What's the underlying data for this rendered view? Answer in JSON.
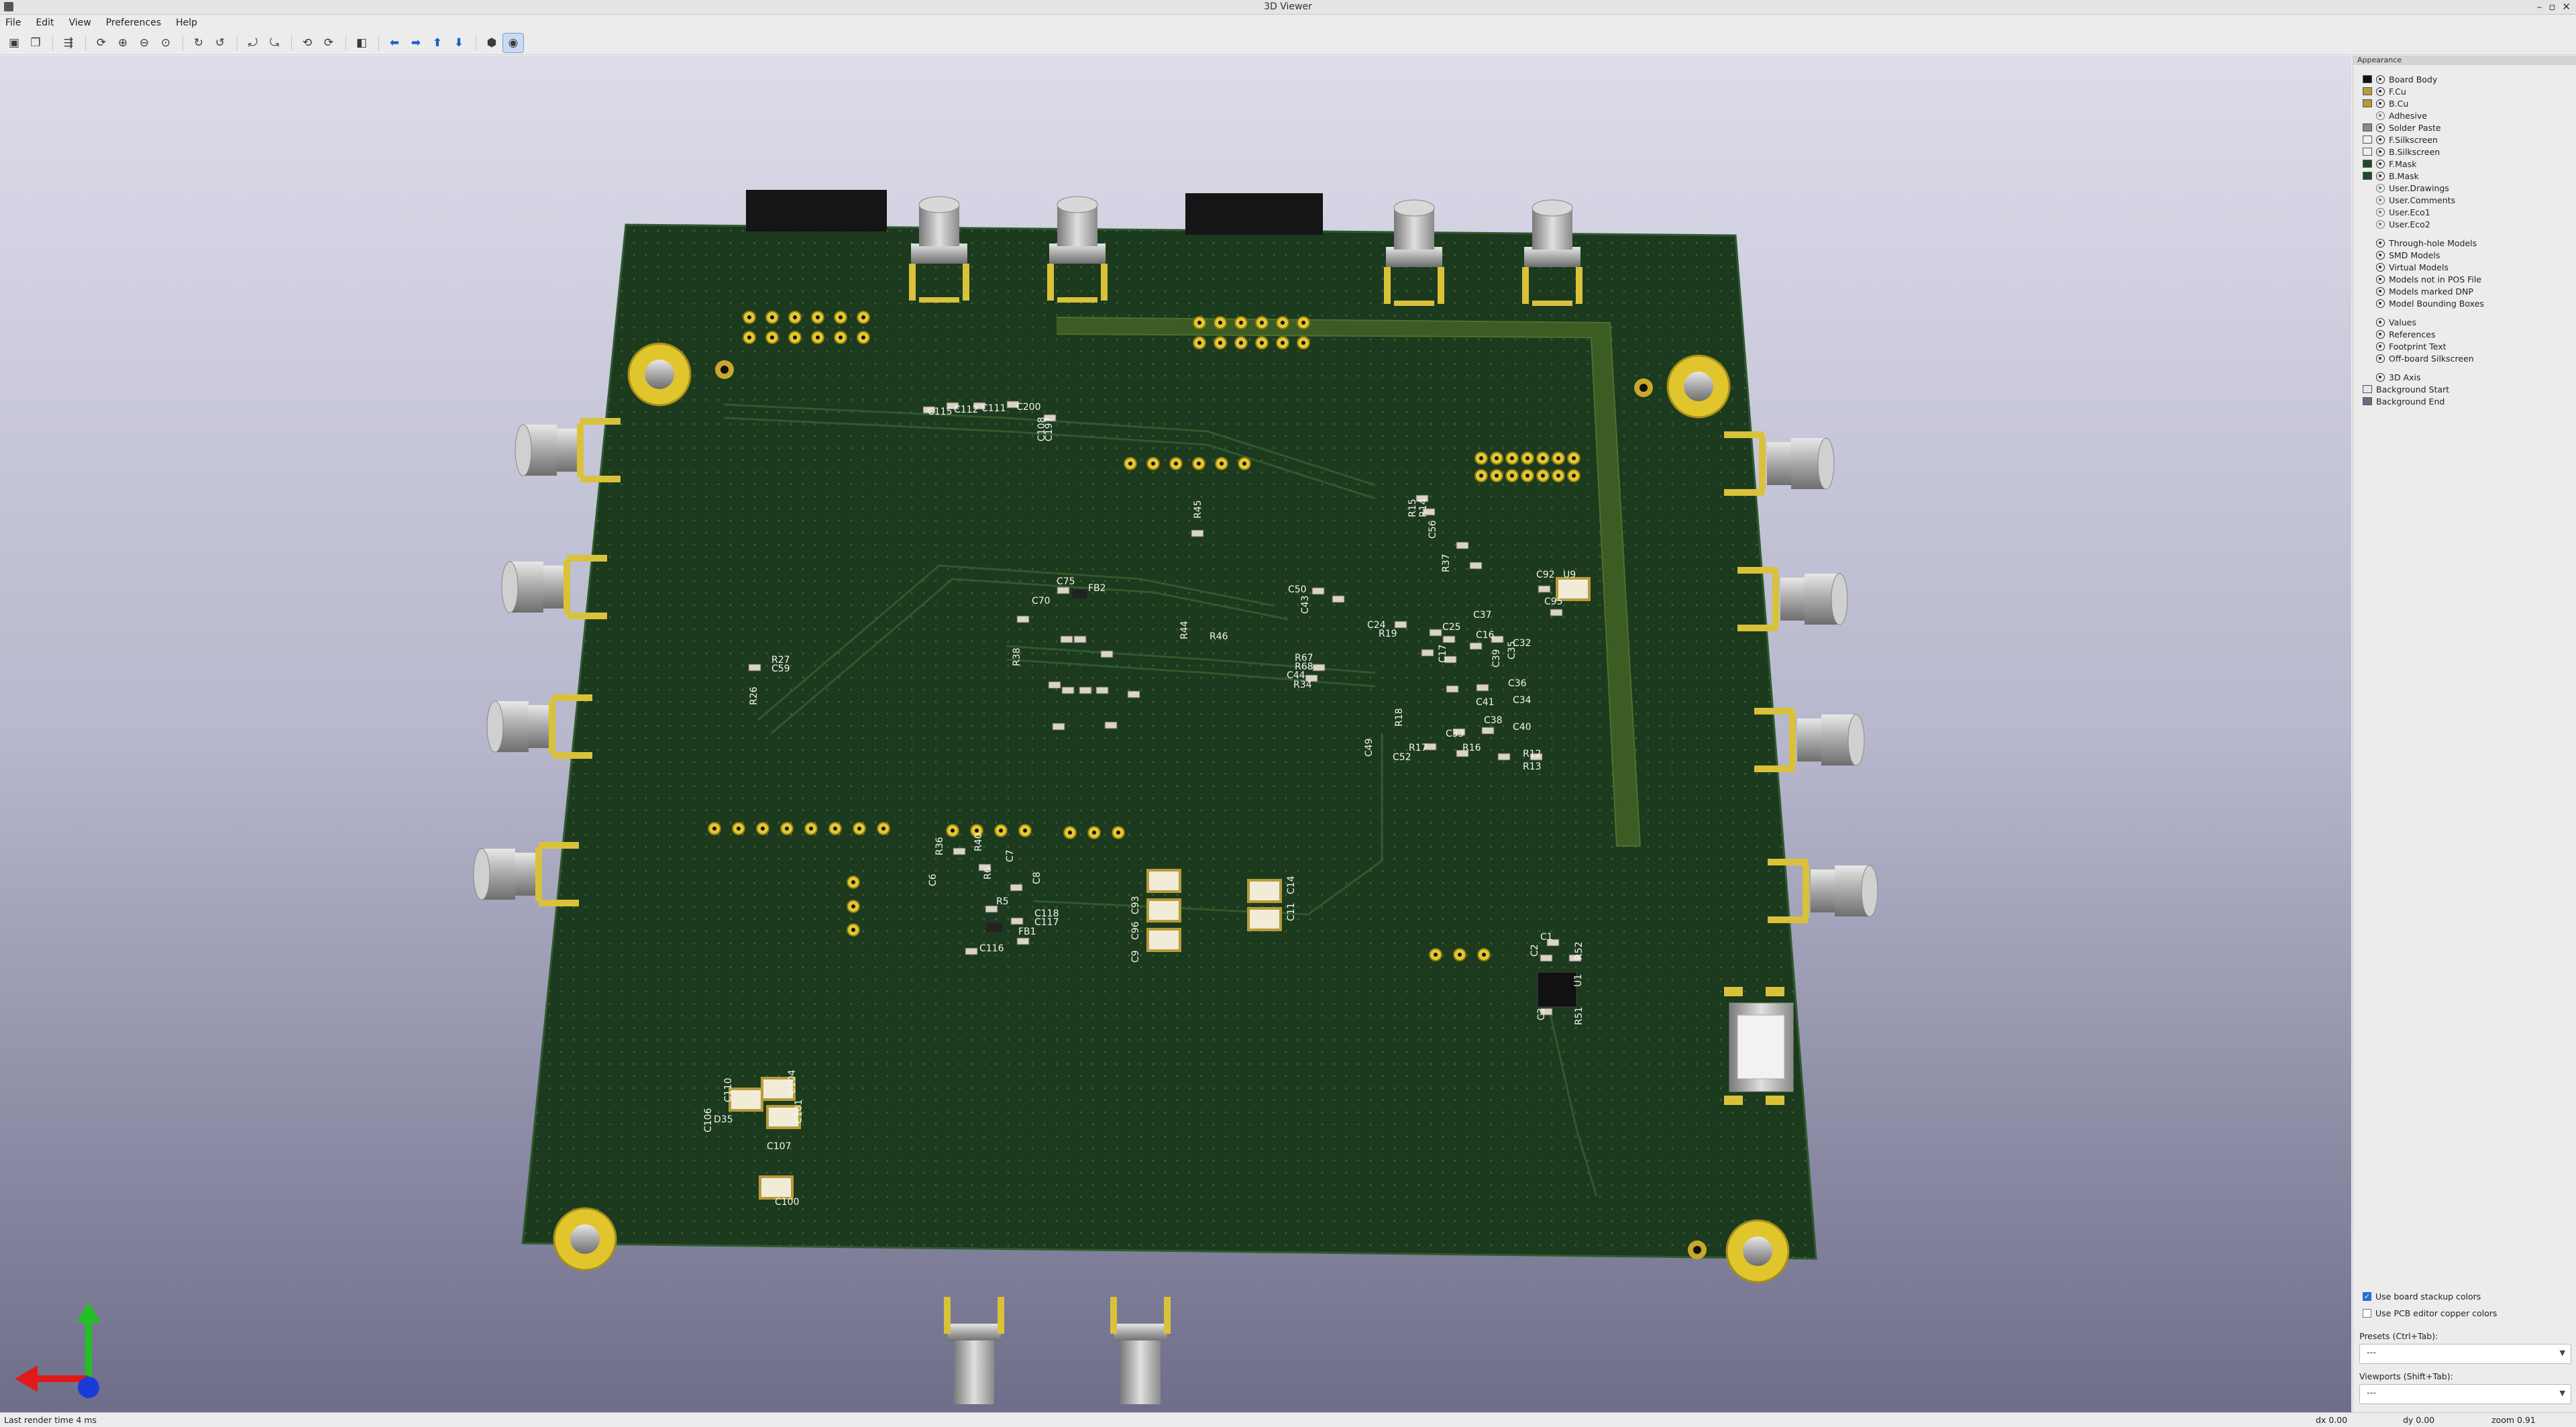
{
  "window": {
    "title": "3D Viewer",
    "controls": [
      "–",
      "▫",
      "✕"
    ]
  },
  "menu": [
    "File",
    "Edit",
    "View",
    "Preferences",
    "Help"
  ],
  "toolbar": [
    {
      "name": "export-image-button",
      "glyph": "▣"
    },
    {
      "name": "copy-button",
      "glyph": "❐"
    },
    {
      "name": "raytrace-button",
      "glyph": "⇶"
    },
    {
      "name": "reload-button",
      "glyph": "⟳"
    },
    {
      "name": "zoom-in-button",
      "glyph": "⊕"
    },
    {
      "name": "zoom-out-button",
      "glyph": "⊖"
    },
    {
      "name": "zoom-fit-button",
      "glyph": "⊙"
    },
    {
      "name": "rotate-x-cw-button",
      "glyph": "↻"
    },
    {
      "name": "rotate-x-ccw-button",
      "glyph": "↺"
    },
    {
      "name": "rotate-y-cw-button",
      "glyph": "⤾"
    },
    {
      "name": "rotate-y-ccw-button",
      "glyph": "⤿"
    },
    {
      "name": "rotate-z-cw-button",
      "glyph": "⟲"
    },
    {
      "name": "rotate-z-ccw-button",
      "glyph": "⟳"
    },
    {
      "name": "flip-board-button",
      "glyph": "◧"
    },
    {
      "name": "pan-left-button",
      "glyph": "⬅",
      "blue": true
    },
    {
      "name": "pan-right-button",
      "glyph": "➡",
      "blue": true
    },
    {
      "name": "pan-up-button",
      "glyph": "⬆",
      "blue": true
    },
    {
      "name": "pan-down-button",
      "glyph": "⬇",
      "blue": true
    },
    {
      "name": "orthographic-button",
      "glyph": "⬢"
    },
    {
      "name": "appearance-toggle-button",
      "glyph": "◉",
      "active": true
    }
  ],
  "appearance": {
    "title": "Appearance",
    "layers": [
      {
        "label": "Board Body",
        "color": "#111111"
      },
      {
        "label": "F.Cu",
        "color": "#b79b3a"
      },
      {
        "label": "B.Cu",
        "color": "#b79b3a"
      },
      {
        "label": "Adhesive",
        "color": ""
      },
      {
        "label": "Solder Paste",
        "color": "#8a8a8a"
      },
      {
        "label": "F.Silkscreen",
        "color": "#f0f0f0"
      },
      {
        "label": "B.Silkscreen",
        "color": "#f0f0f0"
      },
      {
        "label": "F.Mask",
        "color": "#1f4a2a"
      },
      {
        "label": "B.Mask",
        "color": "#1f4a2a"
      },
      {
        "label": "User.Drawings",
        "color": ""
      },
      {
        "label": "User.Comments",
        "color": ""
      },
      {
        "label": "User.Eco1",
        "color": ""
      },
      {
        "label": "User.Eco2",
        "color": ""
      }
    ],
    "objects": [
      "Through-hole Models",
      "SMD Models",
      "Virtual Models",
      "Models not in POS File",
      "Models marked DNP",
      "Model Bounding Boxes"
    ],
    "texts": [
      "Values",
      "References",
      "Footprint Text",
      "Off-board Silkscreen"
    ],
    "axis": {
      "label": "3D Axis"
    },
    "backgrounds": [
      {
        "label": "Background Start",
        "color": "#e6e6f0"
      },
      {
        "label": "Background End",
        "color": "#6b6b88"
      }
    ],
    "use_stackup": "Use board stackup colors",
    "use_pcb_copper": "Use PCB editor copper colors",
    "presets_label": "Presets (Ctrl+Tab):",
    "presets_value": "---",
    "viewports_label": "Viewports (Shift+Tab):",
    "viewports_value": "---"
  },
  "status": {
    "message": "Last render time 4 ms",
    "dx": "dx 0.00",
    "dy": "dy 0.00",
    "zoom": "zoom 0.91"
  },
  "board": {
    "refdes": [
      "C115",
      "C112",
      "C111",
      "C200",
      "C108",
      "C197",
      "R45",
      "R15",
      "R14",
      "C56",
      "R37",
      "C50",
      "C92",
      "U9",
      "C95",
      "C43",
      "C24",
      "R19",
      "C25",
      "C37",
      "C16",
      "C32",
      "C35",
      "C17",
      "C39",
      "C36",
      "C34",
      "C41",
      "C38",
      "C40",
      "C33",
      "R17",
      "R16",
      "R18",
      "C49",
      "C52",
      "R12",
      "R13",
      "R67",
      "R68",
      "C44",
      "R34",
      "FB2",
      "C70",
      "C75",
      "R38",
      "R44",
      "R46",
      "R27",
      "C59",
      "R26",
      "R36",
      "R40",
      "C6",
      "C7",
      "C8",
      "R6",
      "R5",
      "C118",
      "C117",
      "C116",
      "FB1",
      "C93",
      "C96",
      "C9",
      "C14",
      "C11",
      "C1",
      "C2",
      "R52",
      "U1",
      "C3",
      "R51",
      "C110",
      "C104",
      "C101",
      "C106",
      "C107",
      "D35",
      "C100"
    ]
  }
}
